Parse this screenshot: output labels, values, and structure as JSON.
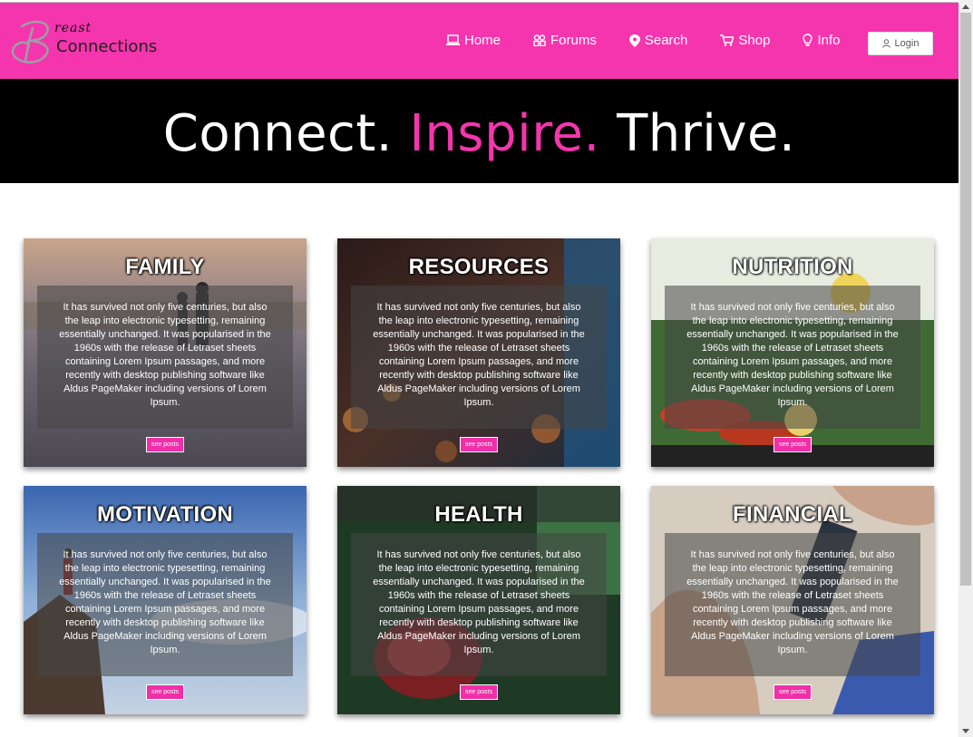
{
  "brand": {
    "script": "reast",
    "word": "Connections"
  },
  "nav": [
    {
      "label": "Home",
      "icon": "laptop-icon"
    },
    {
      "label": "Forums",
      "icon": "users-icon"
    },
    {
      "label": "Search",
      "icon": "map-pin-icon"
    },
    {
      "label": "Shop",
      "icon": "cart-icon"
    },
    {
      "label": "Info",
      "icon": "bulb-icon"
    }
  ],
  "login_label": "Login",
  "hero": {
    "part1": "Connect.",
    "part2": "Inspire.",
    "part3": "Thrive."
  },
  "colors": {
    "brand_pink": "#f535ad",
    "hero_bg": "#000000"
  },
  "cards": [
    {
      "title": "FAMILY",
      "text": "It has survived not only five centuries, but also the leap into electronic typesetting, remaining essentially unchanged. It was popularised in the 1960s with the release of Letraset sheets containing Lorem Ipsum passages, and more recently with desktop publishing software like Aldus PageMaker including versions of Lorem Ipsum.",
      "button": "see posts"
    },
    {
      "title": "RESOURCES",
      "text": "It has survived not only five centuries, but also the leap into electronic typesetting, remaining essentially unchanged. It was popularised in the 1960s with the release of Letraset sheets containing Lorem Ipsum passages, and more recently with desktop publishing software like Aldus PageMaker including versions of Lorem Ipsum.",
      "button": "see posts"
    },
    {
      "title": "NUTRITION",
      "text": "It has survived not only five centuries, but also the leap into electronic typesetting, remaining essentially unchanged. It was popularised in the 1960s with the release of Letraset sheets containing Lorem Ipsum passages, and more recently with desktop publishing software like Aldus PageMaker including versions of Lorem Ipsum.",
      "button": "see posts"
    },
    {
      "title": "MOTIVATION",
      "text": "It has survived not only five centuries, but also the leap into electronic typesetting, remaining essentially unchanged. It was popularised in the 1960s with the release of Letraset sheets containing Lorem Ipsum passages, and more recently with desktop publishing software like Aldus PageMaker including versions of Lorem Ipsum.",
      "button": "see posts"
    },
    {
      "title": "HEALTH",
      "text": "It has survived not only five centuries, but also the leap into electronic typesetting, remaining essentially unchanged. It was popularised in the 1960s with the release of Letraset sheets containing Lorem Ipsum passages, and more recently with desktop publishing software like Aldus PageMaker including versions of Lorem Ipsum.",
      "button": "see posts"
    },
    {
      "title": "FINANCIAL",
      "text": "It has survived not only five centuries, but also the leap into electronic typesetting, remaining essentially unchanged. It was popularised in the 1960s with the release of Letraset sheets containing Lorem Ipsum passages, and more recently with desktop publishing software like Aldus PageMaker including versions of Lorem Ipsum.",
      "button": "see posts"
    }
  ]
}
